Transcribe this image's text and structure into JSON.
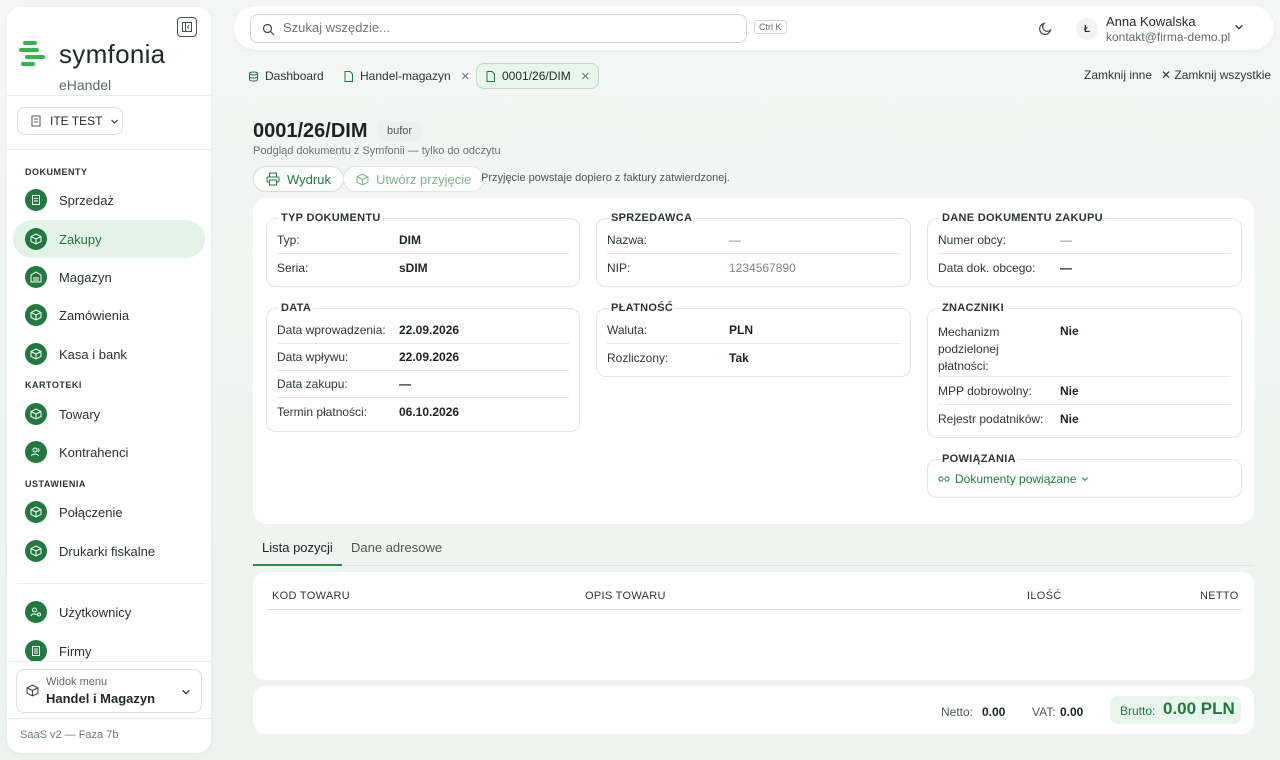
{
  "app": {
    "logo_text": "symfonia",
    "logo_sub": "eHandel"
  },
  "sidebar": {
    "company": "ITE TEST",
    "sections": {
      "documents": "DOKUMENTY",
      "registers": "KARTOTEKI",
      "settings": "USTAWIENIA"
    },
    "items": [
      {
        "label": "Sprzedaż",
        "icon": "receipt-icon"
      },
      {
        "label": "Zakupy",
        "icon": "box-icon",
        "active": true
      },
      {
        "label": "Magazyn",
        "icon": "warehouse-icon"
      },
      {
        "label": "Zamówienia",
        "icon": "box-icon"
      },
      {
        "label": "Kasa i bank",
        "icon": "box-icon"
      },
      {
        "label": "Towary",
        "icon": "box-icon"
      },
      {
        "label": "Kontrahenci",
        "icon": "users-icon"
      },
      {
        "label": "Połączenie",
        "icon": "box-icon"
      },
      {
        "label": "Drukarki fiskalne",
        "icon": "box-icon"
      },
      {
        "label": "Użytkownicy",
        "icon": "user-gear-icon"
      },
      {
        "label": "Firmy",
        "icon": "building-icon"
      }
    ],
    "menu_view_label": "Widok menu",
    "menu_view_value": "Handel i Magazyn",
    "version": "SaaS v2 — Faza 7b"
  },
  "topbar": {
    "search_placeholder": "Szukaj wszędzie...",
    "shortcut": "Ctrl K",
    "avatar_initial": "Ł",
    "user_name": "Anna Kowalska",
    "user_email": "kontakt@firma-demo.pl"
  },
  "tabs": [
    {
      "label": "Dashboard"
    },
    {
      "label": "Handel-magazyn"
    },
    {
      "label": "0001/26/DIM",
      "active": true
    }
  ],
  "tab_actions": {
    "close_others": "Zamknij inne",
    "close_all": "Zamknij wszystkie"
  },
  "document": {
    "title": "0001/26/DIM",
    "badge": "bufor",
    "subtitle": "Podgląd dokumentu z Symfonii — tylko do odczytu",
    "print_btn": "Wydruk",
    "create_btn": "Utwórz przyjęcie",
    "note": "Przyjęcie powstaje dopiero z faktury zatwierdzonej."
  },
  "sections": {
    "typ": {
      "title": "TYP DOKUMENTU",
      "rows": [
        {
          "label": "Typ:",
          "value": "DIM"
        },
        {
          "label": "Seria:",
          "value": "sDIM"
        }
      ]
    },
    "sprzedawca": {
      "title": "SPRZEDAWCA",
      "rows": [
        {
          "label": "Nazwa:",
          "value": "—"
        },
        {
          "label": "NIP:",
          "value": "1234567890"
        }
      ]
    },
    "zakup": {
      "title": "DANE DOKUMENTU ZAKUPU",
      "rows": [
        {
          "label": "Numer obcy:",
          "value": "—"
        },
        {
          "label": "Data dok. obcego:",
          "value": "—"
        }
      ]
    },
    "data": {
      "title": "DATA",
      "rows": [
        {
          "label": "Data wprowadzenia:",
          "value": "22.09.2026"
        },
        {
          "label": "Data wpływu:",
          "value": "22.09.2026"
        },
        {
          "label": "Data zakupu:",
          "value": "—"
        },
        {
          "label": "Termin płatności:",
          "value": "06.10.2026"
        }
      ]
    },
    "platnosc": {
      "title": "PŁATNOŚĆ",
      "rows": [
        {
          "label": "Waluta:",
          "value": "PLN"
        },
        {
          "label": "Rozliczony:",
          "value": "Tak"
        }
      ]
    },
    "znaczniki": {
      "title": "ZNACZNIKI",
      "rows": [
        {
          "label_l1": "Mechanizm",
          "label_l2": "podzielonej",
          "label_l3": "płatności:",
          "value": "Nie"
        },
        {
          "label": "MPP dobrowolny:",
          "value": "Nie"
        },
        {
          "label": "Rejestr podatników:",
          "value": "Nie"
        }
      ]
    },
    "powiazania": {
      "title": "POWIĄZANIA",
      "link": "Dokumenty powiązane"
    }
  },
  "subtabs": [
    {
      "label": "Lista pozycji",
      "active": true
    },
    {
      "label": "Dane adresowe"
    }
  ],
  "table": {
    "headers": [
      "KOD TOWARU",
      "OPIS TOWARU",
      "ILOŚĆ",
      "NETTO"
    ],
    "rows": []
  },
  "totals": {
    "netto_label": "Netto:",
    "netto": "0.00",
    "vat_label": "VAT:",
    "vat": "0.00",
    "brutto_label": "Brutto:",
    "brutto": "0.00 PLN"
  },
  "colors": {
    "accent": "#1d7a3a",
    "accent_bg": "#e4f3e8"
  }
}
